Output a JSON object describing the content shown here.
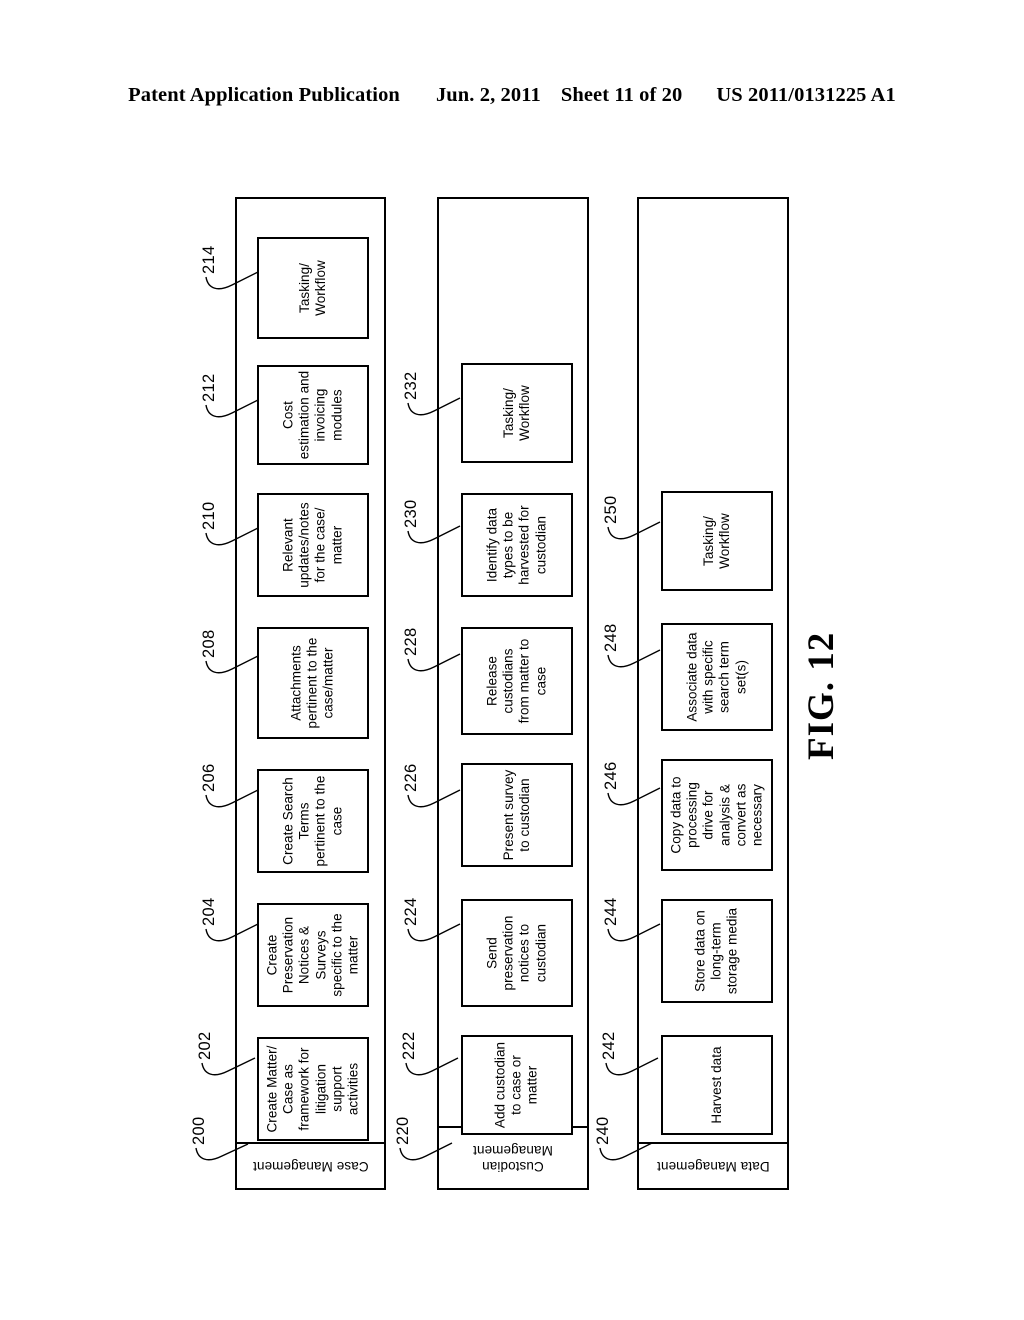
{
  "header": {
    "publication": "Patent Application Publication",
    "date": "Jun. 2, 2011",
    "sheet": "Sheet 11 of 20",
    "patent_number": "US 2011/0131225 A1"
  },
  "figure": {
    "label": "FIG. 12"
  },
  "lanes": [
    {
      "id": "case-management",
      "title": "Case Management",
      "lane_ref": "200",
      "boxes": [
        {
          "ref": "202",
          "text": "Create Matter/\nCase as\nframework for\nlitigation\nsupport\nactivities"
        },
        {
          "ref": "204",
          "text": "Create\nPreservation\nNotices &\nSurveys\nspecific to the\nmatter"
        },
        {
          "ref": "206",
          "text": "Create Search\nTerms\npertinent to the\ncase"
        },
        {
          "ref": "208",
          "text": "Attachments\npertinent to the\ncase/matter"
        },
        {
          "ref": "210",
          "text": "Relevant\nupdates/notes\nfor the case/\nmatter"
        },
        {
          "ref": "212",
          "text": "Cost\nestimation and\ninvoicing\nmodules"
        },
        {
          "ref": "214",
          "text": "Tasking/\nWorkflow"
        }
      ]
    },
    {
      "id": "custodian-management",
      "title": "Custodian\nManagement",
      "lane_ref": "220",
      "boxes": [
        {
          "ref": "222",
          "text": "Add custodian\nto case or\nmatter"
        },
        {
          "ref": "224",
          "text": "Send\npreservation\nnotices to\ncustodian"
        },
        {
          "ref": "226",
          "text": "Present survey\nto custodian"
        },
        {
          "ref": "228",
          "text": "Release\ncustodians\nfrom matter to\ncase"
        },
        {
          "ref": "230",
          "text": "Identify data\ntypes to be\nharvested for\ncustodian"
        },
        {
          "ref": "232",
          "text": "Tasking/\nWorkflow"
        }
      ]
    },
    {
      "id": "data-management",
      "title": "Data Management",
      "lane_ref": "240",
      "boxes": [
        {
          "ref": "242",
          "text": "Harvest data"
        },
        {
          "ref": "244",
          "text": "Store data on\nlong-term\nstorage media"
        },
        {
          "ref": "246",
          "text": "Copy data to\nprocessing\ndrive for\nanalysis &\nconvert as\nnecessary"
        },
        {
          "ref": "248",
          "text": "Associate data\nwith specific\nsearch term\nset(s)"
        },
        {
          "ref": "250",
          "text": "Tasking/\nWorkflow"
        }
      ]
    }
  ]
}
